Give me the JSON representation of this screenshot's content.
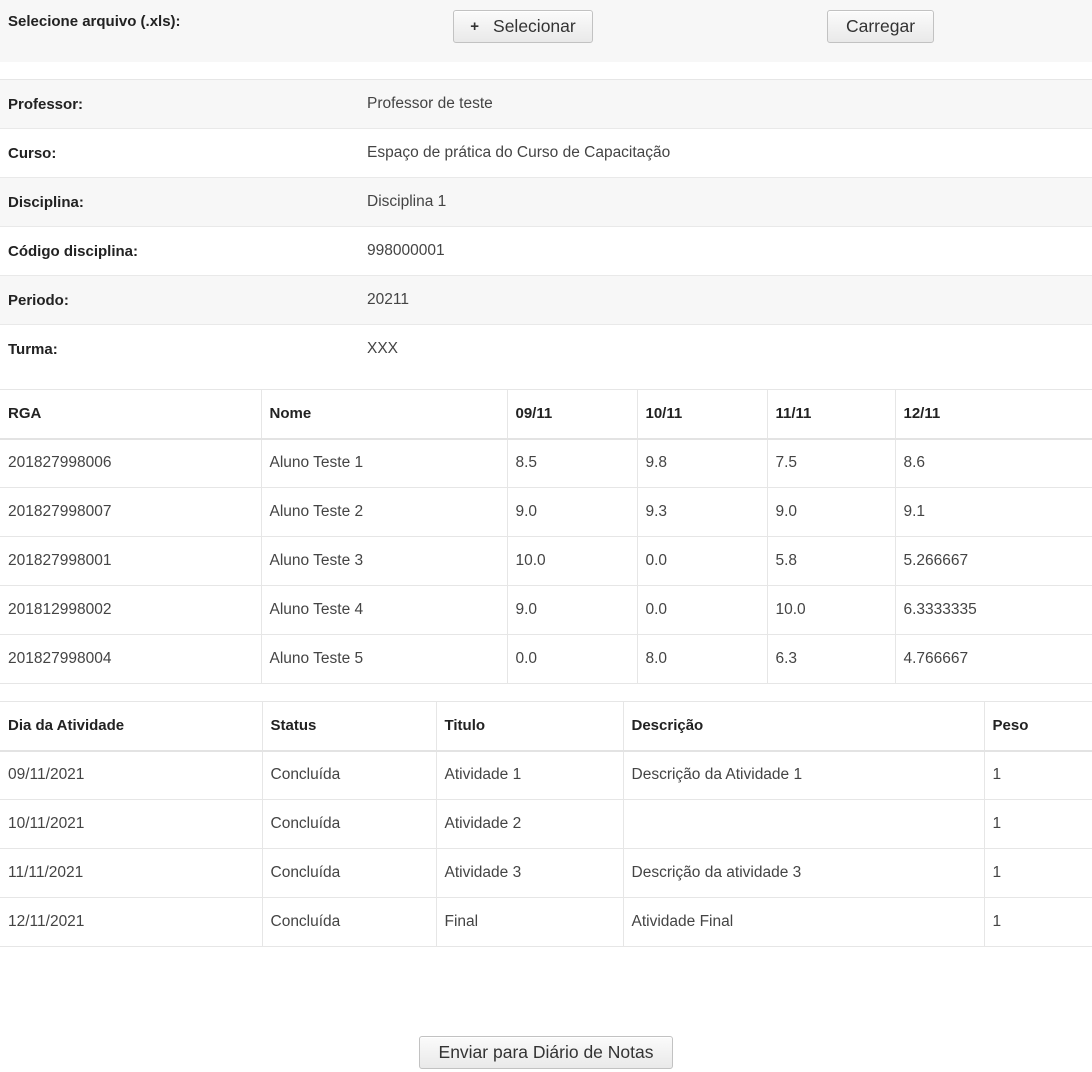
{
  "upload": {
    "label": "Selecione arquivo (.xls):",
    "select_button": "Selecionar",
    "load_button": "Carregar"
  },
  "info": [
    {
      "label": "Professor:",
      "value": "Professor de teste"
    },
    {
      "label": "Curso:",
      "value": "Espaço de prática do Curso de Capacitação"
    },
    {
      "label": "Disciplina:",
      "value": "Disciplina 1"
    },
    {
      "label": "Código disciplina:",
      "value": "998000001"
    },
    {
      "label": "Periodo:",
      "value": "20211"
    },
    {
      "label": "Turma:",
      "value": "XXX"
    }
  ],
  "grades": {
    "headers": [
      "RGA",
      "Nome",
      "09/11",
      "10/11",
      "11/11",
      "12/11"
    ],
    "rows": [
      [
        "201827998006",
        "Aluno Teste 1",
        "8.5",
        "9.8",
        "7.5",
        "8.6"
      ],
      [
        "201827998007",
        "Aluno Teste 2",
        "9.0",
        "9.3",
        "9.0",
        "9.1"
      ],
      [
        "201827998001",
        "Aluno Teste 3",
        "10.0",
        "0.0",
        "5.8",
        "5.266667"
      ],
      [
        "201812998002",
        "Aluno Teste 4",
        "9.0",
        "0.0",
        "10.0",
        "6.3333335"
      ],
      [
        "201827998004",
        "Aluno Teste 5",
        "0.0",
        "8.0",
        "6.3",
        "4.766667"
      ]
    ]
  },
  "activities": {
    "headers": [
      "Dia da Atividade",
      "Status",
      "Titulo",
      "Descrição",
      "Peso"
    ],
    "rows": [
      [
        "09/11/2021",
        "Concluída",
        "Atividade 1",
        "Descrição da Atividade 1",
        "1"
      ],
      [
        "10/11/2021",
        "Concluída",
        "Atividade 2",
        "",
        "1"
      ],
      [
        "11/11/2021",
        "Concluída",
        "Atividade 3",
        "Descrição da atividade 3",
        "1"
      ],
      [
        "12/11/2021",
        "Concluída",
        "Final",
        "Atividade Final",
        "1"
      ]
    ]
  },
  "send_button": "Enviar para Diário de Notas"
}
